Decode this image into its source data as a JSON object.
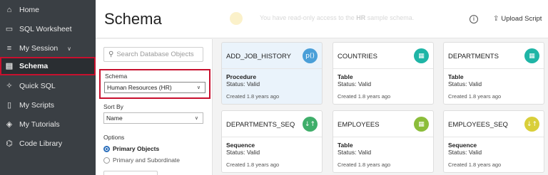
{
  "sidebar": {
    "items": [
      {
        "label": "Home",
        "icon": "home-icon",
        "glyph": "⌂"
      },
      {
        "label": "SQL Worksheet",
        "icon": "terminal-icon",
        "glyph": "▭"
      },
      {
        "label": "My Session",
        "icon": "menu-icon",
        "glyph": "≡",
        "chevron": "∨"
      },
      {
        "label": "Schema",
        "icon": "database-icon",
        "glyph": "▤"
      },
      {
        "label": "Quick SQL",
        "icon": "wand-icon",
        "glyph": "✧"
      },
      {
        "label": "My Scripts",
        "icon": "document-icon",
        "glyph": "▯"
      },
      {
        "label": "My Tutorials",
        "icon": "graduation-cap-icon",
        "glyph": "◈"
      },
      {
        "label": "Code Library",
        "icon": "library-icon",
        "glyph": "⌬"
      }
    ]
  },
  "header": {
    "title": "Schema",
    "notice_prefix": "You have read-only access to the ",
    "notice_bold": "HR",
    "notice_suffix": " sample schema.",
    "help_glyph": "i",
    "upload_label": "Upload Script"
  },
  "filters": {
    "search_placeholder": "Search Database Objects",
    "schema_label": "Schema",
    "schema_value": "Human Resources (HR)",
    "sort_label": "Sort By",
    "sort_value": "Name",
    "options_label": "Options",
    "option1": "Primary Objects",
    "option2": "Primary and Subordinate"
  },
  "cards": [
    {
      "name": "ADD_JOB_HISTORY",
      "type": "Procedure",
      "status": "Status: Valid",
      "created": "Created 1.8 years ago",
      "badge": "p()",
      "color": "#4a9fd8",
      "icon": "procedure-icon"
    },
    {
      "name": "COUNTRIES",
      "type": "Table",
      "status": "Status: Valid",
      "created": "Created 1.8 years ago",
      "badge": "▦",
      "color": "#1fb5a6",
      "icon": "table-icon"
    },
    {
      "name": "DEPARTMENTS",
      "type": "Table",
      "status": "Status: Valid",
      "created": "Created 1.8 years ago",
      "badge": "▦",
      "color": "#1fb5a6",
      "icon": "table-icon"
    },
    {
      "name": "DEPARTMENTS_SEQ",
      "type": "Sequence",
      "status": "Status: Valid",
      "created": "Created 1.8 years ago",
      "badge": "↓↑",
      "color": "#3fae6a",
      "icon": "sequence-icon"
    },
    {
      "name": "EMPLOYEES",
      "type": "Table",
      "status": "Status: Valid",
      "created": "Created 1.8 years ago",
      "badge": "▦",
      "color": "#8bbd3a",
      "icon": "table-icon"
    },
    {
      "name": "EMPLOYEES_SEQ",
      "type": "Sequence",
      "status": "Status: Valid",
      "created": "Created 1.8 years ago",
      "badge": "↓↑",
      "color": "#d9cf3a",
      "icon": "sequence-icon"
    }
  ]
}
